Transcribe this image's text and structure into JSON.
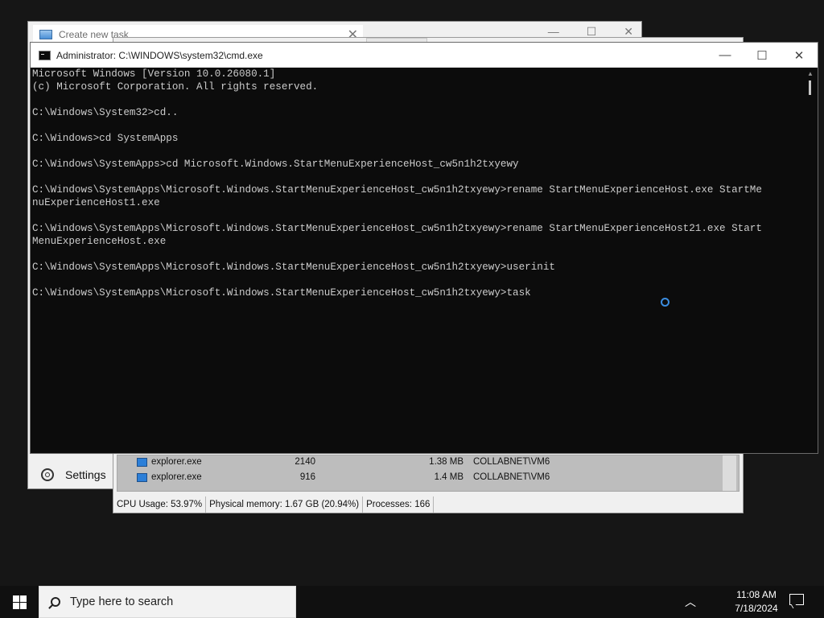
{
  "create_task_window": {
    "title": "Create new task",
    "close_glyph": "✕",
    "caption_min": "—",
    "caption_max": "☐",
    "caption_close": "✕",
    "settings_label": "Settings",
    "settings_icon": "gear-icon"
  },
  "task_manager": {
    "processes": [
      {
        "name": "explorer.exe",
        "pid": "2140",
        "memory": "1.38 MB",
        "user": "COLLABNET\\VM6"
      },
      {
        "name": "explorer.exe",
        "pid": "916",
        "memory": "1.4 MB",
        "user": "COLLABNET\\VM6"
      }
    ],
    "status": {
      "cpu": "CPU Usage: 53.97%",
      "memory": "Physical memory: 1.67 GB (20.94%)",
      "processes": "Processes: 166"
    }
  },
  "cmd_window": {
    "title": "Administrator: C:\\WINDOWS\\system32\\cmd.exe",
    "caption_min": "—",
    "caption_max": "☐",
    "caption_close": "✕",
    "lines": [
      "Microsoft Windows [Version 10.0.26080.1]",
      "(c) Microsoft Corporation. All rights reserved.",
      "",
      "C:\\Windows\\System32>cd..",
      "",
      "C:\\Windows>cd SystemApps",
      "",
      "C:\\Windows\\SystemApps>cd Microsoft.Windows.StartMenuExperienceHost_cw5n1h2txyewy",
      "",
      "C:\\Windows\\SystemApps\\Microsoft.Windows.StartMenuExperienceHost_cw5n1h2txyewy>rename StartMenuExperienceHost.exe StartMe",
      "nuExperienceHost1.exe",
      "",
      "C:\\Windows\\SystemApps\\Microsoft.Windows.StartMenuExperienceHost_cw5n1h2txyewy>rename StartMenuExperienceHost21.exe Start",
      "MenuExperienceHost.exe",
      "",
      "C:\\Windows\\SystemApps\\Microsoft.Windows.StartMenuExperienceHost_cw5n1h2txyewy>userinit",
      "",
      "C:\\Windows\\SystemApps\\Microsoft.Windows.StartMenuExperienceHost_cw5n1h2txyewy>task"
    ]
  },
  "taskbar": {
    "search_placeholder": "Type here to search",
    "tray_up": "︿",
    "time": "11:08 AM",
    "date": "7/18/2024"
  },
  "colors": {
    "cmd_background": "#0c0c0c",
    "cmd_text": "#cccccc",
    "desktop": "#161616",
    "spinner": "#3b8de0"
  }
}
